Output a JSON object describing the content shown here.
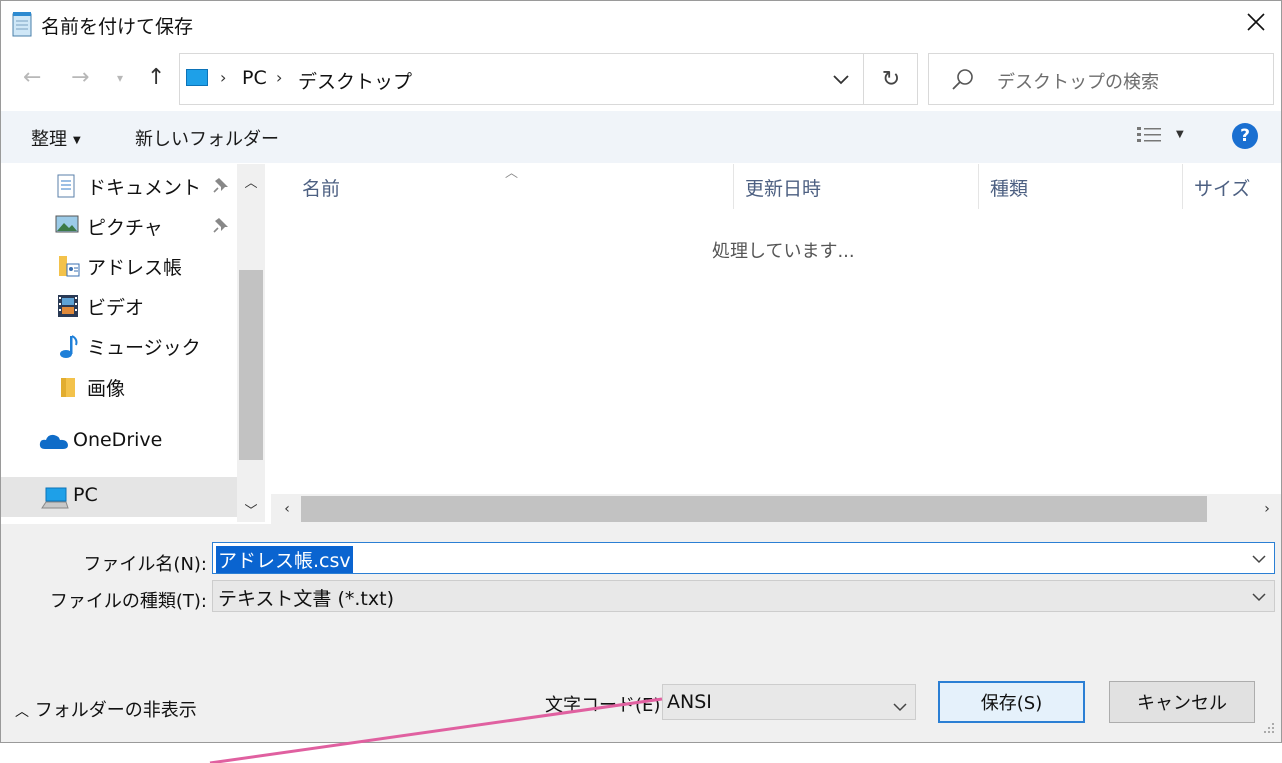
{
  "window": {
    "title": "名前を付けて保存"
  },
  "address": {
    "segments": [
      "PC",
      "デスクトップ"
    ],
    "search_placeholder": "デスクトップの検索"
  },
  "toolbar": {
    "organize": "整理",
    "new_folder": "新しいフォルダー"
  },
  "nav_pane": {
    "items": [
      {
        "label": "ドキュメント",
        "icon": "documents-icon",
        "pinned": true
      },
      {
        "label": "ピクチャ",
        "icon": "pictures-icon",
        "pinned": true
      },
      {
        "label": "アドレス帳",
        "icon": "contacts-folder-icon",
        "pinned": false
      },
      {
        "label": "ビデオ",
        "icon": "video-icon",
        "pinned": false
      },
      {
        "label": "ミュージック",
        "icon": "music-icon",
        "pinned": false
      },
      {
        "label": "画像",
        "icon": "folder-icon",
        "pinned": false
      },
      {
        "label": "OneDrive",
        "icon": "onedrive-cloud-icon",
        "pinned": false
      },
      {
        "label": "PC",
        "icon": "pc-icon",
        "pinned": false,
        "selected": true
      }
    ]
  },
  "file_list": {
    "columns": [
      "名前",
      "更新日時",
      "種類",
      "サイズ"
    ],
    "status": "処理しています..."
  },
  "form": {
    "filename_label": "ファイル名(N):",
    "filename_value": "アドレス帳.csv",
    "filetype_label": "ファイルの種類(T):",
    "filetype_value": "テキスト文書 (*.txt)",
    "hide_folders": "フォルダーの非表示",
    "encoding_label": "文字コード(E):",
    "encoding_value": "ANSI",
    "save_button": "保存(S)",
    "cancel_button": "キャンセル"
  },
  "colors": {
    "accent": "#2b7fd4",
    "selection": "#0a64d0",
    "toolbar_bg": "#f0f4f9",
    "annotation_line": "#e060a0"
  }
}
